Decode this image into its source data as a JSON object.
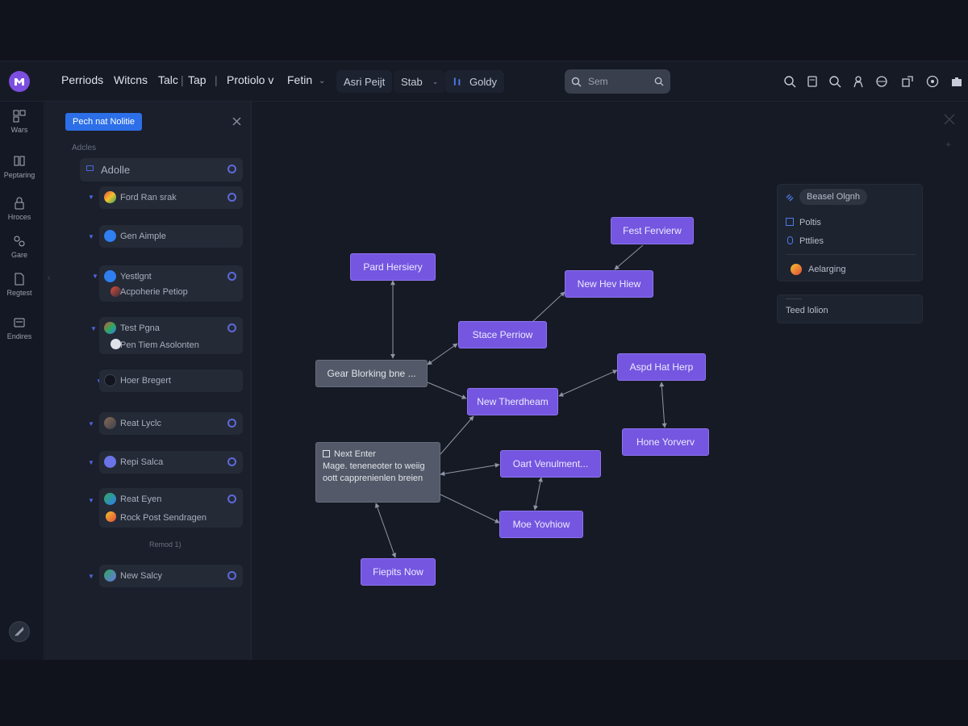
{
  "topbar": {
    "nav": [
      "Perriods",
      "Witcns",
      "Talc",
      "Tap",
      "Protiolo v",
      "Fetin"
    ],
    "pill_1": "Asri Peijt",
    "pill_2": "Stab",
    "pill_3": "Goldy",
    "search_placeholder": "Sem"
  },
  "rail": {
    "items": [
      "Wars",
      "Peptaring",
      "Hroces",
      "Gare",
      "Regtest",
      "Endires"
    ]
  },
  "panel": {
    "primary_button": "Pech nat Nolitie",
    "section_label": "Adcles",
    "header_row": "Adolle",
    "rows": [
      {
        "label": "Ford Ran srak",
        "sub": ""
      },
      {
        "label": "Gen Aimple",
        "sub": ""
      },
      {
        "label": "Yestlgnt",
        "sub": "Acpoherie Petiop"
      },
      {
        "label": "Test Pgna",
        "sub": "Pen Tiem Asolonten"
      },
      {
        "label": "Hoer Bregert",
        "sub": ""
      },
      {
        "label": "Reat Lyclc",
        "sub": ""
      },
      {
        "label": "Repi Salca",
        "sub": ""
      },
      {
        "label": "Reat Eyen",
        "sub": "Rock Post Sendragen"
      },
      {
        "label": "New Salcy",
        "sub": ""
      }
    ],
    "footer_note": "Remod 1)"
  },
  "nodes": {
    "fest_fervierw": "Fest Fervierw",
    "pard_hersiery": "Pard Hersiery",
    "new_hev_hiew": "New Hev Hiew",
    "stace_perriow": "Stace Perriow",
    "gear_blorking": "Gear Blorking bne ...",
    "new_therdheam": "New Therdheam",
    "aspd_hat_herp": "Aspd Hat Herp",
    "hone_yorverv": "Hone Yorverv",
    "next_enter_title": "Next Enter",
    "next_enter_body": "Mage. teneneoter to weiig oott capprenienlen breien",
    "oart_venulment": "Oart Venulment...",
    "moe_yovhiow": "Moe Yovhiow",
    "fiepits_now": "Fiepits Now"
  },
  "inspector": {
    "chip": "Beasel Olgnh",
    "items": [
      "Poltis",
      "Pttlies"
    ],
    "assignee": "Aelarging",
    "footer_card": "Teed lolion"
  },
  "colors": {
    "node": "#7456e0",
    "node_gray": "#535968",
    "accent": "#2c6fe8",
    "logo": "#7b4ee0"
  }
}
